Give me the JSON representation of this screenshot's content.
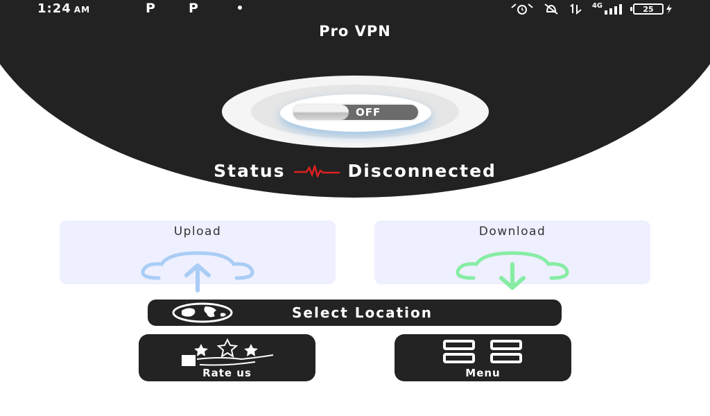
{
  "status_bar": {
    "time": "1:24",
    "ampm": "AM",
    "notification_icons": [
      "P",
      "P"
    ],
    "network": "4G",
    "battery": "25"
  },
  "app": {
    "title": "Pro VPN"
  },
  "toggle": {
    "label": "OFF"
  },
  "connection": {
    "status_label": "Status",
    "status_value": "Disconnected"
  },
  "cards": {
    "upload_label": "Upload",
    "download_label": "Download"
  },
  "actions": {
    "select_location": "Select Location",
    "rate_us": "Rate us",
    "menu": "Menu"
  },
  "colors": {
    "header": "#222222",
    "upload_icon": "#a9cdf5",
    "download_icon": "#86eda4",
    "pulse": "#e02020",
    "card_bg": "#eeefff"
  }
}
